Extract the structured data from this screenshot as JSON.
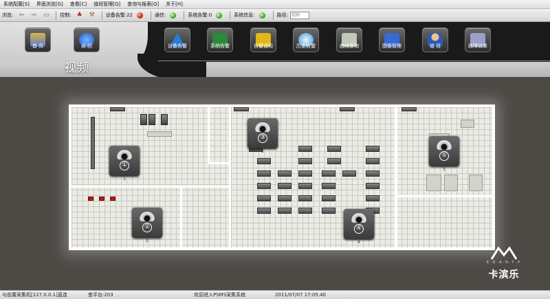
{
  "menu": [
    "系统配置[S]",
    "界面浏览[G]",
    "查看[C]",
    "值班管理[Q]",
    "查询与报表[Q]",
    "关于[H]"
  ],
  "toolbar": {
    "browse_label": "浏览:",
    "control_label": "控制:",
    "device_alarm": "设备告警:22",
    "comm_label": "通信:",
    "system_alarm": "系统告警:0",
    "system_info": "系统信息:",
    "path_label": "路径:",
    "path_value": "视频"
  },
  "nav_left": [
    {
      "label": "首 页",
      "icon": "home-icon"
    },
    {
      "label": "返 回",
      "icon": "back-arrow-icon"
    }
  ],
  "nav_right": [
    {
      "label": "设备告警",
      "icon": "warning-icon",
      "color": "#2a7bd6"
    },
    {
      "label": "系统告警",
      "icon": "system-board-icon",
      "color": "#2a8a3a"
    },
    {
      "label": "告警通知",
      "icon": "notice-icon",
      "color": "#e0b81a"
    },
    {
      "label": "历史告警",
      "icon": "history-clock-icon",
      "color": "#3a9ad0"
    },
    {
      "label": "曲线查询",
      "icon": "chart-curve-icon",
      "color": "#c0c8b8"
    },
    {
      "label": "图像管理",
      "icon": "monitor-icon",
      "color": "#3a6ad0"
    },
    {
      "label": "值 班",
      "icon": "person-icon",
      "color": "#2a5ab0"
    },
    {
      "label": "故障派单",
      "icon": "document-icon",
      "color": "#9aa0c8"
    }
  ],
  "page_title": "视频",
  "cameras": [
    {
      "num": "①",
      "label": "1"
    },
    {
      "num": "②",
      "label": "2"
    },
    {
      "num": "③",
      "label": "3"
    },
    {
      "num": "④",
      "label": "4"
    },
    {
      "num": "⑤",
      "label": "5"
    }
  ],
  "logo": {
    "sub": "E·D·A·N·T·P",
    "text": "卡滨乐"
  },
  "status": {
    "collector": "与前置采集机[127.0.0.1]直连",
    "platform": "查平台:203",
    "welcome": "欢迎进入PSMS采集系统",
    "datetime": "2011/07/07 17:05:40"
  },
  "colors": {
    "accent_red": "#c42a1a",
    "accent_green": "#3ea82a",
    "header_dark": "#1a1a1a"
  }
}
